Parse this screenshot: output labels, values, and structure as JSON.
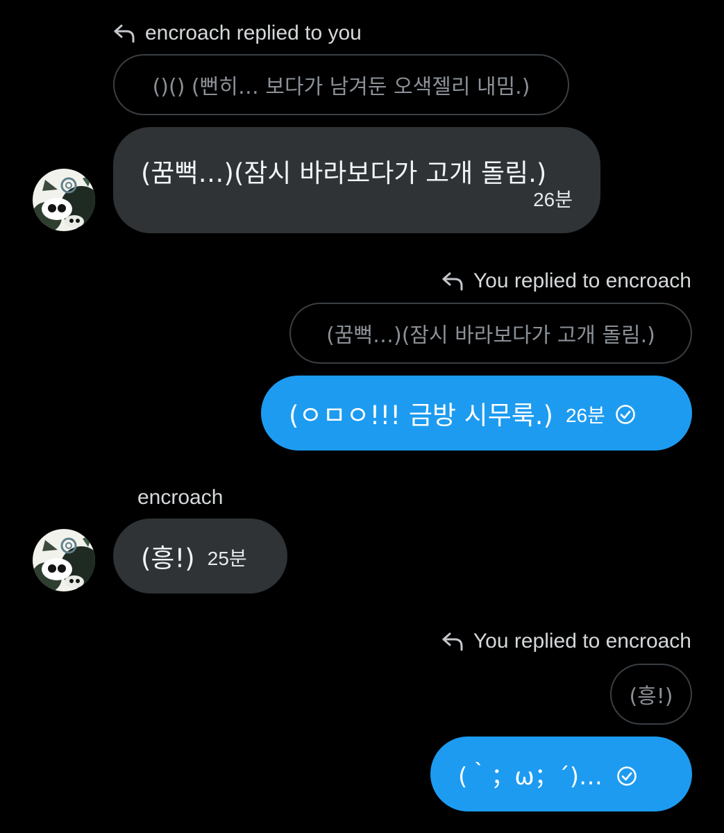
{
  "conversation": {
    "colors": {
      "background": "#000000",
      "incoming_bubble": "#2f3336",
      "outgoing_bubble": "#1d9bf0",
      "muted_text": "#8b9197"
    },
    "block1": {
      "reply_header": "encroach replied to you",
      "quoted_text": "()() (뻔히… 보다가 남겨둔 오색젤리 내밈.)",
      "message_text": "(꿈뻑…)(잠시 바라보다가 고개 돌림.)",
      "timestamp": "26분",
      "avatar_icon": "avatar-image"
    },
    "block2": {
      "reply_header": "You replied to encroach",
      "quoted_text": "(꿈뻑…)(잠시 바라보다가 고개 돌림.)",
      "message_text": "(ㅇㅁㅇ!!! 금방 시무룩.)",
      "timestamp": "26분",
      "status_icon": "check-circle-icon"
    },
    "block3": {
      "sender_name": "encroach",
      "message_text": "(흥!)",
      "timestamp": "25분",
      "avatar_icon": "avatar-image"
    },
    "block4": {
      "reply_header": "You replied to encroach",
      "quoted_text": "(흥!)",
      "message_text": "(｀；ω；´)…",
      "status_icon": "check-circle-icon"
    }
  }
}
